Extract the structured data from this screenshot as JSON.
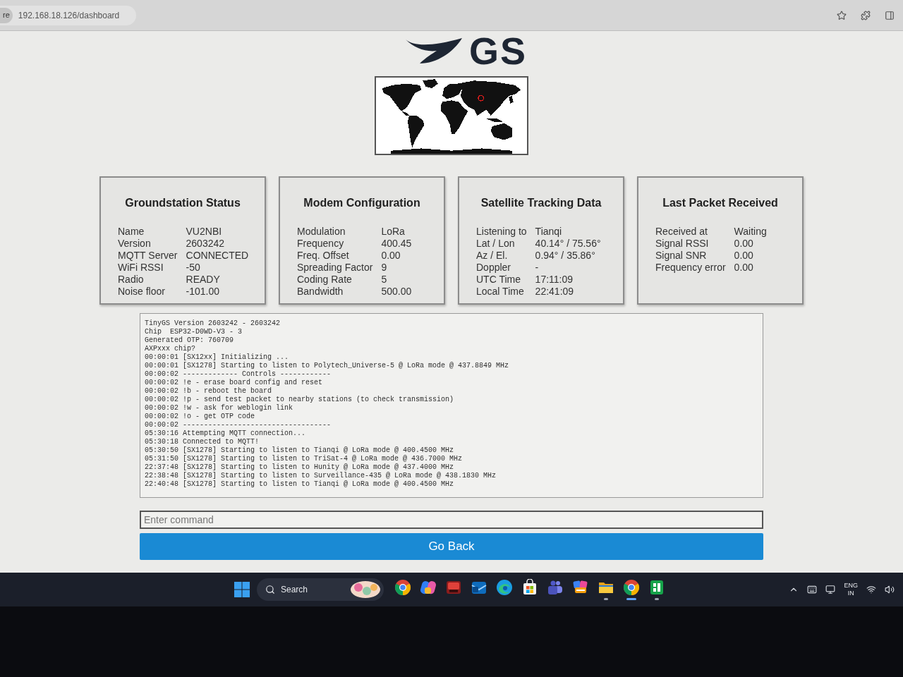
{
  "browser": {
    "security_chip": "re",
    "url": "192.168.18.126/dashboard"
  },
  "logo": {
    "text": "GS"
  },
  "cards": [
    {
      "title": "Groundstation Status",
      "rows": [
        {
          "label": "Name",
          "value": "VU2NBI"
        },
        {
          "label": "Version",
          "value": "2603242"
        },
        {
          "label": "MQTT Server",
          "value": "CONNECTED"
        },
        {
          "label": "WiFi RSSI",
          "value": "-50"
        },
        {
          "label": "Radio",
          "value": "READY"
        },
        {
          "label": "Noise floor",
          "value": "-101.00"
        }
      ]
    },
    {
      "title": "Modem Configuration",
      "rows": [
        {
          "label": "Modulation",
          "value": "LoRa"
        },
        {
          "label": "Frequency",
          "value": "400.45"
        },
        {
          "label": "Freq. Offset",
          "value": "0.00"
        },
        {
          "label": "Spreading Factor",
          "value": "9"
        },
        {
          "label": "Coding Rate",
          "value": "5"
        },
        {
          "label": "Bandwidth",
          "value": "500.00"
        }
      ]
    },
    {
      "title": "Satellite Tracking Data",
      "rows": [
        {
          "label": "Listening to",
          "value": "Tianqi"
        },
        {
          "label": "Lat / Lon",
          "value": "40.14° / 75.56°"
        },
        {
          "label": "Az / El.",
          "value": "0.94° / 35.86°"
        },
        {
          "label": "Doppler",
          "value": "-"
        },
        {
          "label": "UTC Time",
          "value": "17:11:09"
        },
        {
          "label": "Local Time",
          "value": "22:41:09"
        }
      ]
    },
    {
      "title": "Last Packet Received",
      "rows": [
        {
          "label": "Received at",
          "value": "Waiting"
        },
        {
          "label": "Signal RSSI",
          "value": "0.00"
        },
        {
          "label": "Signal SNR",
          "value": "0.00"
        },
        {
          "label": "Frequency error",
          "value": "0.00"
        }
      ]
    }
  ],
  "console": {
    "lines": [
      "TinyGS Version 2603242 - 2603242",
      "Chip  ESP32-D0WD-V3 - 3",
      "Generated OTP: 760709",
      "AXPxxx chip?",
      "00:00:01 [SX12xx] Initializing ...",
      "00:00:01 [SX1278] Starting to listen to Polytech_Universe-5 @ LoRa mode @ 437.8849 MHz",
      "00:00:02 ------------- Controls ------------",
      "00:00:02 !e - erase board config and reset",
      "00:00:02 !b - reboot the board",
      "00:00:02 !p - send test packet to nearby stations (to check transmission)",
      "00:00:02 !w - ask for weblogin link",
      "00:00:02 !o - get OTP code",
      "00:00:02 -----------------------------------",
      "05:30:16 Attempting MQTT connection...",
      "05:30:18 Connected to MQTT!",
      "05:30:50 [SX1278] Starting to listen to Tianqi @ LoRa mode @ 400.4500 MHz",
      "05:31:50 [SX1278] Starting to listen to TriSat-4 @ LoRa mode @ 436.7000 MHz",
      "22:37:48 [SX1278] Starting to listen to Hunity @ LoRa mode @ 437.4000 MHz",
      "22:38:48 [SX1278] Starting to listen to Surveillance-435 @ LoRa mode @ 438.1830 MHz",
      "22:40:48 [SX1278] Starting to listen to Tianqi @ LoRa mode @ 400.4500 MHz"
    ]
  },
  "command_input": {
    "placeholder": "Enter command"
  },
  "go_back_button": {
    "label": "Go Back"
  },
  "taskbar": {
    "search": {
      "placeholder": "Search"
    },
    "apps": [
      {
        "kind": "browser",
        "running": false,
        "active": false
      },
      {
        "kind": "sparkle",
        "running": false,
        "active": false
      },
      {
        "kind": "toolbox",
        "running": false,
        "active": false
      },
      {
        "kind": "mail",
        "running": false,
        "active": false
      },
      {
        "kind": "wave",
        "running": false,
        "active": false
      },
      {
        "kind": "bag",
        "running": false,
        "active": false
      },
      {
        "kind": "people",
        "running": false,
        "active": false
      },
      {
        "kind": "tiles",
        "running": false,
        "active": false
      },
      {
        "kind": "folder",
        "running": true,
        "active": false
      },
      {
        "kind": "browser",
        "running": true,
        "active": true
      },
      {
        "kind": "sheet",
        "running": true,
        "active": false
      }
    ],
    "tray": {
      "language": "ENG",
      "region": "IN"
    }
  }
}
